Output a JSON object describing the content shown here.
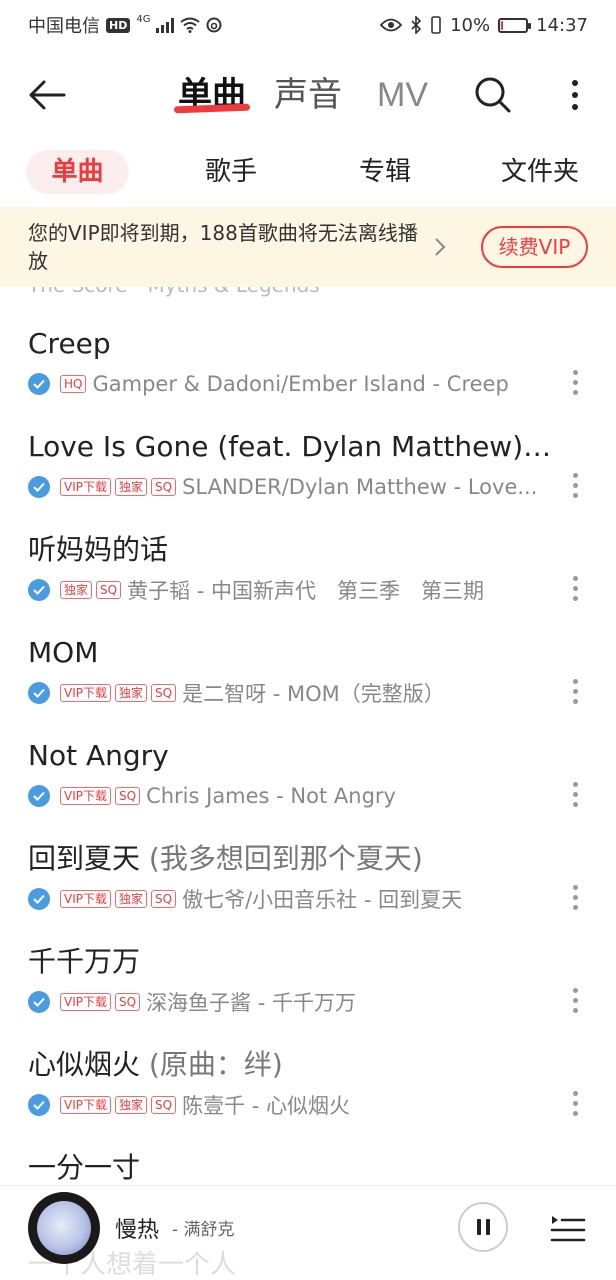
{
  "status_bar": {
    "carrier": "中国电信",
    "hd": "HD",
    "network": "4G",
    "battery_percent": "10%",
    "battery_level": 0.1,
    "time": "14:37"
  },
  "top_nav": {
    "tabs": [
      {
        "label": "单曲",
        "active": true
      },
      {
        "label": "声音",
        "active": false
      },
      {
        "label": "MV",
        "active": false
      }
    ]
  },
  "sub_tabs": [
    {
      "label": "单曲",
      "active": true
    },
    {
      "label": "歌手",
      "active": false
    },
    {
      "label": "专辑",
      "active": false
    },
    {
      "label": "文件夹",
      "active": false
    }
  ],
  "vip_banner": {
    "message": "您的VIP即将到期，188首歌曲将无法离线播放",
    "button": "续费VIP"
  },
  "partial_row_text": "The Score - Myths & Legends",
  "songs": [
    {
      "title": "Creep",
      "subtitle": "",
      "tags": [
        "HQ"
      ],
      "meta": "Gamper & Dadoni/Ember Island - Creep"
    },
    {
      "title": "Love Is Gone (feat. Dylan Matthew) (...",
      "subtitle": "",
      "tags": [
        "VIP下载",
        "独家",
        "SQ"
      ],
      "meta": "SLANDER/Dylan Matthew - Love..."
    },
    {
      "title": "听妈妈的话",
      "subtitle": "",
      "tags": [
        "独家",
        "SQ"
      ],
      "meta": "黄子韬 - 中国新声代　第三季　第三期"
    },
    {
      "title": "MOM",
      "subtitle": "",
      "tags": [
        "VIP下载",
        "独家",
        "SQ"
      ],
      "meta": "是二智呀 - MOM（完整版）"
    },
    {
      "title": "Not Angry",
      "subtitle": "",
      "tags": [
        "VIP下载",
        "SQ"
      ],
      "meta": "Chris James - Not Angry"
    },
    {
      "title": "回到夏天",
      "subtitle": " (我多想回到那个夏天)",
      "tags": [
        "VIP下载",
        "独家",
        "SQ"
      ],
      "meta": "傲七爷/小田音乐社 - 回到夏天"
    },
    {
      "title": "千千万万",
      "subtitle": "",
      "tags": [
        "VIP下载",
        "SQ"
      ],
      "meta": "深海鱼子酱 - 千千万万"
    },
    {
      "title": "心似烟火",
      "subtitle": " (原曲：绊)",
      "tags": [
        "VIP下载",
        "独家",
        "SQ"
      ],
      "meta": "陈壹千 - 心似烟火"
    },
    {
      "title": "一分一寸",
      "subtitle": "",
      "tags": [],
      "meta": ""
    }
  ],
  "player": {
    "title": "慢热",
    "artist": "- 满舒克",
    "ghost_text": "一个人想着一个人"
  },
  "colors": {
    "accent": "#ef3b3e",
    "verified": "#4a9be0",
    "banner_bg": "#fdf6e3"
  },
  "icons": [
    "back-arrow-icon",
    "search-icon",
    "more-vertical-icon",
    "chevron-right-icon",
    "check-circle-icon",
    "pause-icon",
    "playlist-icon"
  ]
}
